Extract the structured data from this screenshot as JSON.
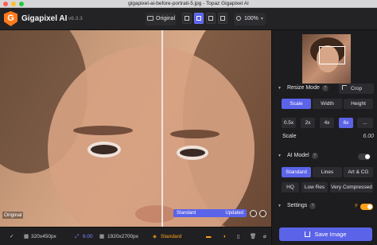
{
  "window": {
    "title": "gigapixel-ai-before-portrait-5.jpg - Topaz Gigapixel AI"
  },
  "toolbar": {
    "app_name": "Gigapixel AI",
    "version": "v6.3.3",
    "original_label": "Original",
    "zoom_label": "100%"
  },
  "preview": {
    "original_label": "Original",
    "model_label": "Standard",
    "model_status": "Updated"
  },
  "bottombar": {
    "input_size": "320x450px",
    "scale": "6.00",
    "output_size": "1920x2700px",
    "model": "Standard"
  },
  "panel": {
    "resize_mode_title": "Resize Mode",
    "crop_label": "Crop",
    "resize_options": [
      "Scale",
      "Width",
      "Height"
    ],
    "scale_options": [
      "0.5x",
      "2x",
      "4x",
      "6x",
      "..."
    ],
    "scale_label": "Scale",
    "scale_value": "6.00",
    "ai_model_title": "AI Model",
    "model_options": [
      "Standard",
      "Lines",
      "Art & CG",
      "HQ",
      "Low Res",
      "Very Compressed"
    ],
    "settings_title": "Settings",
    "save_label": "Save Image"
  },
  "colors": {
    "accent": "#5b63e8",
    "orange": "#ffa21a",
    "panel_bg": "#1d1d20"
  }
}
